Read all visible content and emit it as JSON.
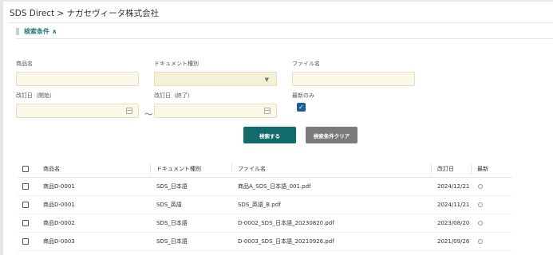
{
  "breadcrumb": "SDS Direct > ナガセヴィータ株式会社",
  "search_section": {
    "title": "検索条件",
    "toggle_glyph": "∧"
  },
  "form": {
    "product_name_label": "商品名",
    "product_name_value": "",
    "doc_type_label": "ドキュメント種別",
    "doc_type_value": "",
    "file_name_label": "ファイル名",
    "file_name_value": "",
    "rev_start_label": "改訂日（開始）",
    "rev_start_value": "",
    "rev_end_label": "改訂日（終了）",
    "rev_end_value": "",
    "range_separator": "～",
    "latest_only_label": "最新のみ",
    "latest_only_checked": true,
    "search_button": "検索する",
    "clear_button": "検索条件クリア"
  },
  "table": {
    "headers": {
      "product": "商品名",
      "doc_type": "ドキュメント種別",
      "file": "ファイル名",
      "rev_date": "改訂日",
      "latest": "最新"
    },
    "rows": [
      {
        "product": "商品D-0001",
        "doc_type": "SDS_日本語",
        "file": "商品A_SDS_日本語_001.pdf",
        "rev_date": "2024/12/21"
      },
      {
        "product": "商品D-0001",
        "doc_type": "SDS_英語",
        "file": "SDS_英語_B.pdf",
        "rev_date": "2024/11/21"
      },
      {
        "product": "商品D-0002",
        "doc_type": "SDS_日本語",
        "file": "D-0002_SDS_日本語_20230820.pdf",
        "rev_date": "2023/08/20"
      },
      {
        "product": "商品D-0003",
        "doc_type": "SDS_日本語",
        "file": "D-0003_SDS_日本語_20210926.pdf",
        "rev_date": "2021/09/26"
      }
    ]
  },
  "icons": {
    "select_caret": "▼",
    "check": "✓"
  }
}
